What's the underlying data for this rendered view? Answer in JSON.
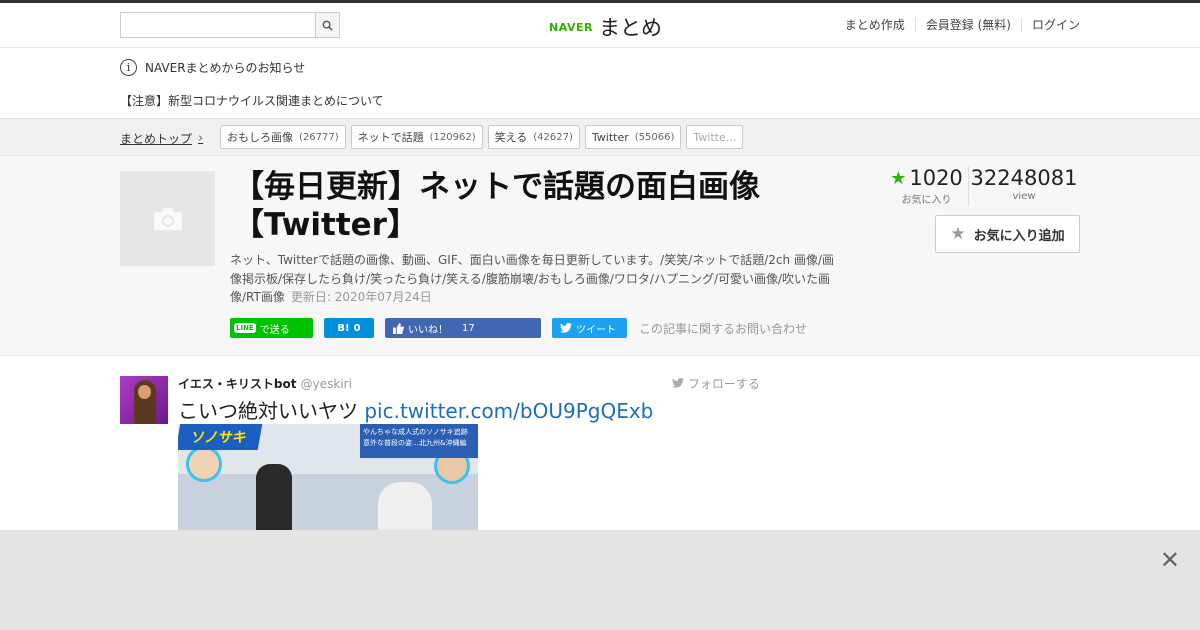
{
  "header": {
    "search_placeholder": "",
    "logo_brand": "NAVER",
    "logo_name": "まとめ",
    "links": [
      "まとめ作成",
      "会員登録 (無料)",
      "ログイン"
    ]
  },
  "notice": {
    "title": "NAVERまとめからのお知らせ",
    "item": "【注意】新型コロナウイルス関連まとめについて"
  },
  "breadcrumb": {
    "top": "まとめトップ",
    "tags": [
      {
        "label": "おもしろ画像",
        "count": "(26777)"
      },
      {
        "label": "ネットで話題",
        "count": "(120962)"
      },
      {
        "label": "笑える",
        "count": "(42627)"
      },
      {
        "label": "Twitter",
        "count": "(55066)"
      },
      {
        "label": "Twitte...",
        "count": ""
      }
    ]
  },
  "article": {
    "title": "【毎日更新】ネットで話題の面白画像【Twitter】",
    "description": "ネット、Twitterで話題の画像、動画、GIF、面白い画像を毎日更新しています。/笑笑/ネットで話題/2ch 画像/画像掲示板/保存したら負け/笑ったら負け/笑える/腹筋崩壊/おもしろ画像/ワロタ/ハプニング/可愛い画像/吹いた画像/RT画像",
    "updated": "更新日: 2020年07月24日",
    "favorites": "1020",
    "favorites_label": "お気に入り",
    "views": "32248081",
    "views_label": "view",
    "fav_button": "お気に入り追加",
    "contact": "この記事に関するお問い合わせ"
  },
  "share": {
    "line_badge": "LINE",
    "line": "で送る",
    "hatena": "B!",
    "hatena_count": "0",
    "fb": "いいね！",
    "fb_count": "17",
    "tw": "ツイート"
  },
  "tweet": {
    "name": "イエス・キリストbot",
    "handle": "@yeskiri",
    "follow": "フォローする",
    "text": "こいつ絶対いいヤツ",
    "link": "pic.twitter.com/bOU9PgQExb",
    "img_tele": "ソノサキ",
    "img_caption": "やんちゃな成人式のソノサキ追跡 意外な普段の姿…北九州&沖縄編"
  },
  "colors": {
    "brand_green": "#2db400",
    "link_blue": "#1a6ec2",
    "line_green": "#00c300",
    "hatena_blue": "#008fde",
    "fb_blue": "#4267b2",
    "tw_blue": "#1da1f2"
  }
}
